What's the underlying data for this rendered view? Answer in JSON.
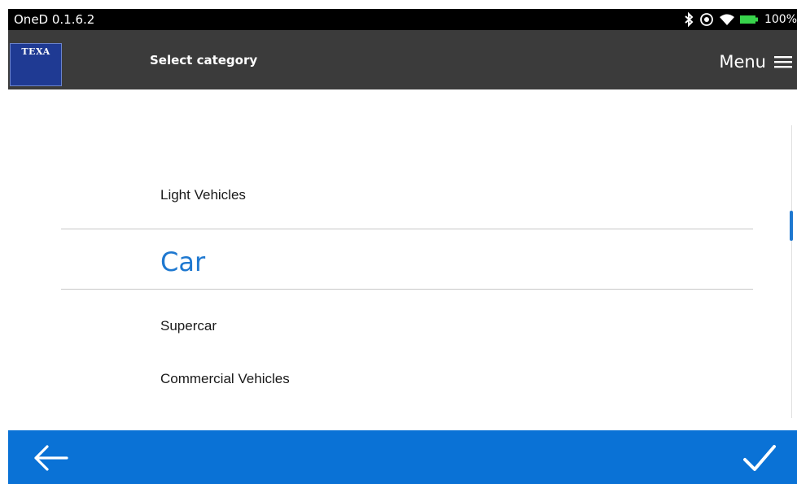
{
  "statusbar": {
    "app_version": "OneD 0.1.6.2",
    "battery": "100%",
    "icons": [
      "bluetooth-icon",
      "location-icon",
      "wifi-icon",
      "battery-icon"
    ]
  },
  "header": {
    "logo_text": "TEXA",
    "title": "Select category",
    "menu_label": "Menu",
    "background": "#3b3b3b"
  },
  "list": {
    "items": [
      {
        "label": "Light Vehicles",
        "selected": false
      },
      {
        "label": "Car",
        "selected": true
      },
      {
        "label": "Supercar",
        "selected": false
      },
      {
        "label": "Commercial Vehicles",
        "selected": false
      }
    ],
    "accent": "#1e78d0"
  },
  "bottombar": {
    "background": "#0a72d6",
    "back_icon": "arrow-left-icon",
    "confirm_icon": "checkmark-icon"
  }
}
